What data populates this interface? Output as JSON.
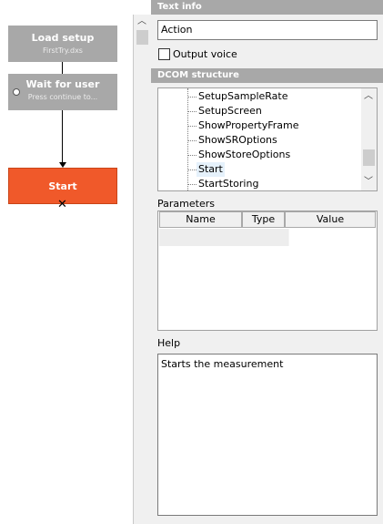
{
  "flow": {
    "nodes": [
      {
        "title": "Load setup",
        "subtitle": "FirstTry.dxs"
      },
      {
        "title": "Wait for user",
        "subtitle": "Press continue to..."
      },
      {
        "title": "Start"
      }
    ],
    "colors": {
      "node": "#a8a8a8",
      "active": "#f0592a"
    }
  },
  "scrollbar": {
    "up_icon": "chevron-up-icon"
  },
  "panel": {
    "text_info_header": "Text info",
    "action_value": "Action",
    "output_voice_label": "Output voice",
    "output_voice_checked": false,
    "dcom_header": "DCOM structure",
    "tree_items": [
      "SetupSampleRate",
      "SetupScreen",
      "ShowPropertyFrame",
      "ShowSROptions",
      "ShowStoreOptions",
      "Start",
      "StartStoring"
    ],
    "tree_selected": "Start",
    "parameters_label": "Parameters",
    "parameters_columns": [
      "Name",
      "Type",
      "Value"
    ],
    "help_label": "Help",
    "help_text": "Starts the measurement"
  }
}
